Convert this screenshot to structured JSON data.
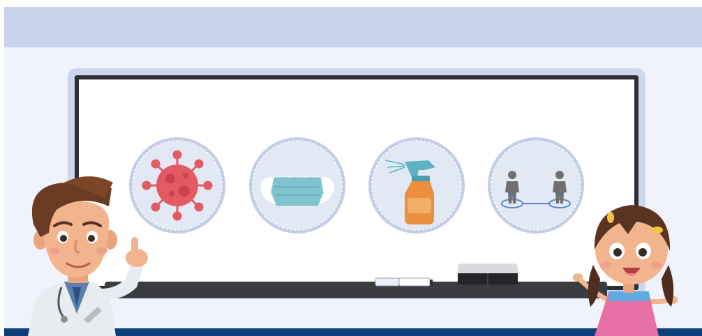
{
  "scene": {
    "colors": {
      "top_band": "#c9d4ec",
      "wall": "#f0f3fb",
      "board_frame": "#2e2f33",
      "board_glow": "#cdd6ee",
      "board_surface": "#ffffff",
      "tray": "#3b3c40",
      "floor_stripe": "#0d3f7a",
      "icon_circle_fill": "#e3e8f5",
      "icon_circle_ring": "#c3cde6",
      "virus": "#e35a63",
      "mask": "#7fc4cf",
      "spray_bottle": "#e98f3d",
      "spray_nozzle": "#5bb3c3",
      "person": "#6f6f72",
      "distance_line": "#5b84d6"
    },
    "icons": [
      {
        "name": "virus-icon"
      },
      {
        "name": "face-mask-icon"
      },
      {
        "name": "disinfectant-spray-icon"
      },
      {
        "name": "social-distancing-icon"
      }
    ],
    "characters": [
      {
        "name": "doctor-character"
      },
      {
        "name": "girl-character"
      }
    ]
  }
}
